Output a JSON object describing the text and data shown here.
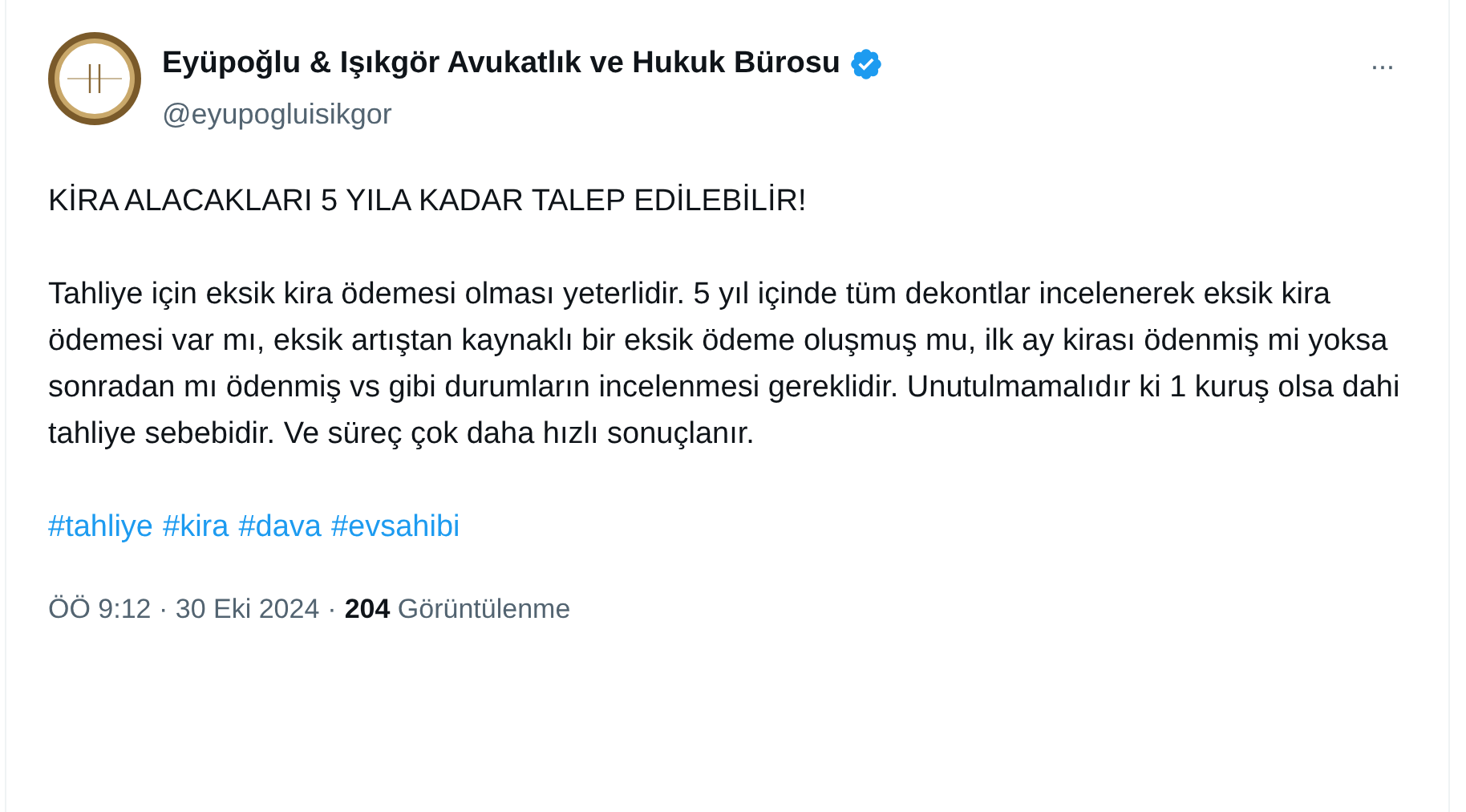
{
  "author": {
    "name": "Eyüpoğlu & Işıkgör Avukatlık ve Hukuk Bürosu",
    "verified": true,
    "handle": "@eyupogluisikgor"
  },
  "menu": "···",
  "body": {
    "headline": "KİRA ALACAKLARI 5 YILA KADAR TALEP EDİLEBİLİR!",
    "paragraph": "Tahliye için eksik kira ödemesi olması yeterlidir. 5 yıl içinde tüm dekontlar incelenerek eksik kira ödemesi var mı, eksik artıştan kaynaklı bir eksik ödeme oluşmuş mu, ilk ay kirası ödenmiş mi yoksa sonradan mı ödenmiş vs gibi durumların incelenmesi gereklidir. Unutulmamalıdır ki 1 kuruş olsa dahi tahliye sebebidir. Ve süreç çok daha hızlı sonuçlanır.",
    "hashtags": [
      "#tahliye",
      "#kira",
      "#dava",
      "#evsahibi"
    ]
  },
  "meta": {
    "timestamp": "ÖÖ 9:12 · 30 Eki 2024",
    "separator": "·",
    "views": "**204** Görüntülenme"
  }
}
